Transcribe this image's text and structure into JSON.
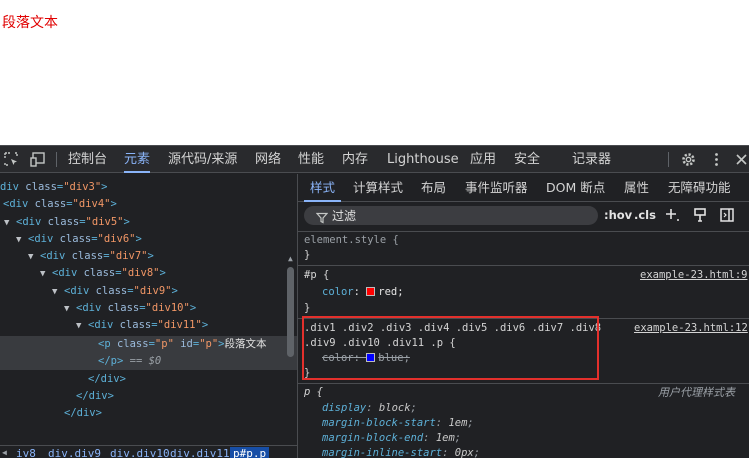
{
  "page": {
    "paragraph_text": "段落文本"
  },
  "toolbar": {
    "tabs": [
      "控制台",
      "元素",
      "源代码/来源",
      "网络",
      "性能",
      "内存",
      "Lighthouse",
      "应用",
      "安全",
      "记录器"
    ],
    "active_tab": "元素"
  },
  "elements": {
    "rows": [
      {
        "t": "div",
        "cls": "div3",
        "text": "div class=\"div3\">"
      },
      {
        "t": "div",
        "cls": "div4",
        "text": "<div class=\"div4\">"
      },
      {
        "text": "<div class=\"div5\">"
      },
      {
        "text": "<div class=\"div6\">"
      },
      {
        "text": "<div class=\"div7\">"
      },
      {
        "text": "<div class=\"div8\">"
      },
      {
        "text": "<div class=\"div9\">"
      },
      {
        "text": "<div class=\"div10\">"
      },
      {
        "text": "<div class=\"div11\">"
      }
    ],
    "selected": {
      "class": "p",
      "id": "p",
      "text": "段落文本"
    },
    "close_p": "</p>",
    "eq_marker": "== $0",
    "close_div": "</div>"
  },
  "breadcrumb": [
    "iv8",
    "div.div9",
    "div.div10",
    "div.div11",
    "p#p.p"
  ],
  "styles": {
    "tabs": [
      "样式",
      "计算样式",
      "布局",
      "事件监听器",
      "DOM 断点",
      "属性",
      "无障碍功能"
    ],
    "active_tab": "样式",
    "filter_placeholder": "过滤",
    "hov": ":hov",
    "cls": ".cls",
    "rules": {
      "element_style": {
        "selector": "element.style {",
        "close": "}"
      },
      "p_id": {
        "selector": "#p {",
        "prop": "color",
        "value": "red",
        "swatch": "#ff0000",
        "source": "example-23.html:9",
        "close": "}"
      },
      "long": {
        "selector_line1": ".div1 .div2 .div3 .div4 .div5 .div6 .div7 .div8",
        "selector_line2": ".div9 .div10 .div11 .p {",
        "prop": "color",
        "value": "blue",
        "swatch": "#0000ff",
        "source": "example-23.html:12",
        "close": "}"
      },
      "ua": {
        "selector": "p {",
        "source": "用户代理样式表",
        "decls": [
          {
            "prop": "display",
            "value": "block"
          },
          {
            "prop": "margin-block-start",
            "value": "1em"
          },
          {
            "prop": "margin-block-end",
            "value": "1em"
          },
          {
            "prop": "margin-inline-start",
            "value": "0px"
          }
        ]
      }
    }
  }
}
